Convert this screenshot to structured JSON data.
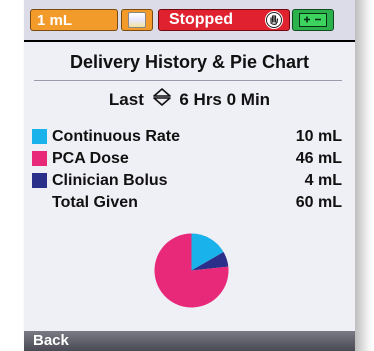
{
  "status": {
    "volume": "1 mL",
    "state": "Stopped",
    "icons": [
      "bag-icon",
      "stop-hand-icon",
      "battery-icon"
    ],
    "colors": {
      "volume": "#f29a2a",
      "state": "#e02230",
      "battery": "#2bb24c"
    }
  },
  "screen": {
    "title": "Delivery History & Pie Chart",
    "last_label": "Last",
    "last_value": "6 Hrs 0 Min"
  },
  "rows": [
    {
      "label": "Continuous Rate",
      "value": "10 mL",
      "color": "#1ab2ea"
    },
    {
      "label": "PCA Dose",
      "value": "46 mL",
      "color": "#e8297a"
    },
    {
      "label": "Clinician Bolus",
      "value": "4 mL",
      "color": "#2a2f8a"
    },
    {
      "label": "Total Given",
      "value": "60 mL",
      "color": ""
    }
  ],
  "chart_data": {
    "type": "pie",
    "categories": [
      "Continuous Rate",
      "PCA Dose",
      "Clinician Bolus"
    ],
    "values": [
      10,
      46,
      4
    ],
    "colors": [
      "#1ab2ea",
      "#e8297a",
      "#2a2f8a"
    ]
  },
  "footer": {
    "back_label": "Back"
  }
}
